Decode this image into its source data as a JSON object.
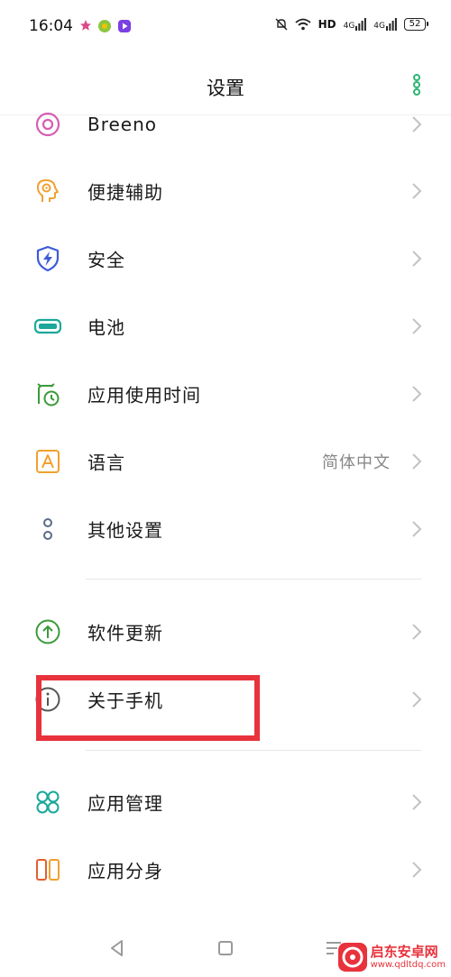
{
  "status_bar": {
    "time": "16:04",
    "network": "HD",
    "signal1": "4G",
    "signal2": "4G",
    "battery": "52"
  },
  "header": {
    "title": "设置"
  },
  "settings": {
    "items": [
      {
        "label": "Breeno",
        "icon": "breeno-icon",
        "color": "#d65db1"
      },
      {
        "label": "便捷辅助",
        "icon": "assist-icon",
        "color": "#f0a030"
      },
      {
        "label": "安全",
        "icon": "shield-icon",
        "color": "#3d5bd9"
      },
      {
        "label": "电池",
        "icon": "battery-icon",
        "color": "#1aa89a"
      },
      {
        "label": "应用使用时间",
        "icon": "alarm-clock-icon",
        "color": "#3a9a3a"
      },
      {
        "label": "语言",
        "icon": "language-icon",
        "color": "#f0a030",
        "value": "简体中文"
      },
      {
        "label": "其他设置",
        "icon": "more-settings-icon",
        "color": "#5a6a8a"
      },
      {
        "label": "软件更新",
        "icon": "update-icon",
        "color": "#3a9a3a"
      },
      {
        "label": "关于手机",
        "icon": "info-icon",
        "color": "#555555"
      },
      {
        "label": "应用管理",
        "icon": "app-grid-icon",
        "color": "#1aa89a"
      },
      {
        "label": "应用分身",
        "icon": "app-clone-icon",
        "color": "#e06030"
      }
    ]
  },
  "watermark": {
    "title": "启东安卓网",
    "url": "www.qdltdq.com"
  },
  "colors": {
    "highlight": "#e8323c",
    "accent": "#2bb673"
  }
}
